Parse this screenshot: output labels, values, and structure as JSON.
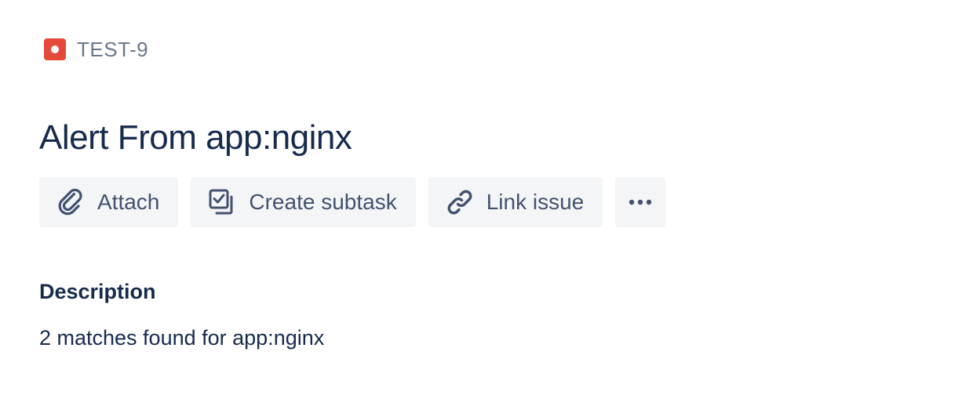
{
  "issue": {
    "key": "TEST-9",
    "type_icon": "bug-icon",
    "type_color": "#e5493a",
    "title": "Alert From app:nginx"
  },
  "toolbar": {
    "attach": {
      "label": "Attach",
      "icon": "paperclip-icon"
    },
    "create_subtask": {
      "label": "Create subtask",
      "icon": "subtask-icon"
    },
    "link_issue": {
      "label": "Link issue",
      "icon": "link-icon"
    },
    "more": {
      "icon": "more-icon"
    }
  },
  "description": {
    "heading": "Description",
    "text": "2 matches found for app:nginx"
  },
  "colors": {
    "text_primary": "#172b4d",
    "text_secondary": "#6b778c",
    "button_bg": "#f4f5f7",
    "icon": "#42526e"
  }
}
